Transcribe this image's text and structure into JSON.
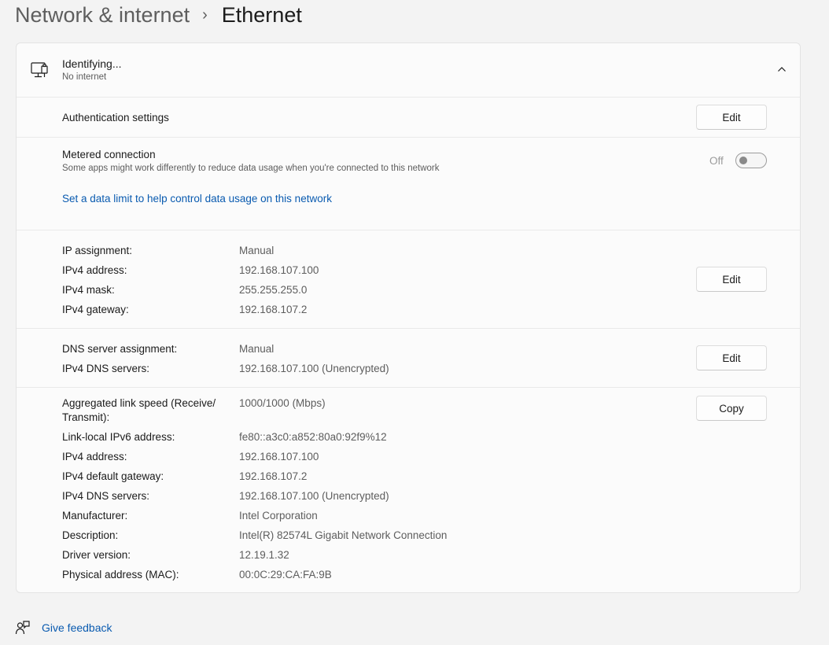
{
  "breadcrumb": {
    "parent": "Network & internet",
    "separator": "›",
    "current": "Ethernet"
  },
  "header": {
    "title": "Identifying...",
    "subtitle": "No internet"
  },
  "authentication": {
    "label": "Authentication settings",
    "button": "Edit"
  },
  "metered": {
    "label": "Metered connection",
    "description": "Some apps might work differently to reduce data usage when you're connected to this network",
    "toggle_state": "Off",
    "link": "Set a data limit to help control data usage on this network"
  },
  "ip": {
    "button": "Edit",
    "rows": [
      {
        "label": "IP assignment:",
        "value": "Manual"
      },
      {
        "label": "IPv4 address:",
        "value": "192.168.107.100"
      },
      {
        "label": "IPv4 mask:",
        "value": "255.255.255.0"
      },
      {
        "label": "IPv4 gateway:",
        "value": "192.168.107.2"
      }
    ]
  },
  "dns": {
    "button": "Edit",
    "rows": [
      {
        "label": "DNS server assignment:",
        "value": "Manual"
      },
      {
        "label": "IPv4 DNS servers:",
        "value": "192.168.107.100 (Unencrypted)"
      }
    ]
  },
  "properties": {
    "button": "Copy",
    "speed_label_line1": "Aggregated link speed (Receive/",
    "speed_label_line2": "Transmit):",
    "speed_value": "1000/1000 (Mbps)",
    "rows": [
      {
        "label": "Link-local IPv6 address:",
        "value": "fe80::a3c0:a852:80a0:92f9%12"
      },
      {
        "label": "IPv4 address:",
        "value": "192.168.107.100"
      },
      {
        "label": "IPv4 default gateway:",
        "value": "192.168.107.2"
      },
      {
        "label": "IPv4 DNS servers:",
        "value": "192.168.107.100 (Unencrypted)"
      },
      {
        "label": "Manufacturer:",
        "value": "Intel Corporation"
      },
      {
        "label": "Description:",
        "value": "Intel(R) 82574L Gigabit Network Connection"
      },
      {
        "label": "Driver version:",
        "value": "12.19.1.32"
      },
      {
        "label": "Physical address (MAC):",
        "value": "00:0C:29:CA:FA:9B"
      }
    ]
  },
  "feedback": {
    "label": "Give feedback"
  },
  "icons": {
    "ethernet": "ethernet-icon",
    "chevron": "chevron-up-icon",
    "feedback": "feedback-icon"
  },
  "colors": {
    "link": "#0a5bb0",
    "background": "#f3f3f3",
    "card": "#fbfbfb"
  }
}
